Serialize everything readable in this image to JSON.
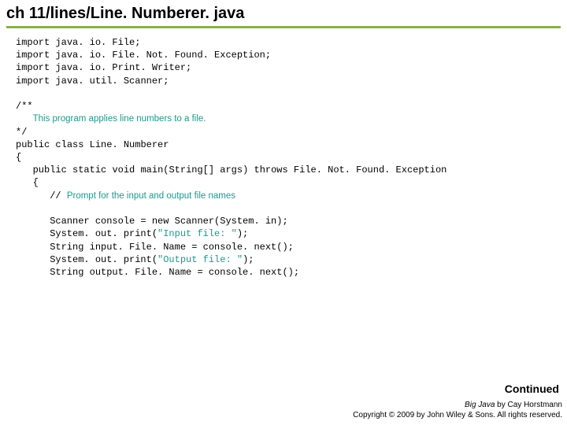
{
  "title": "ch 11/lines/Line. Numberer. java",
  "imp_kw": "import",
  "pub_kw": "public",
  "cls_kw": "class",
  "stat_kw": "static",
  "void_kw": "void",
  "throws_kw": "throws",
  "new_kw": "new",
  "imp1": " java. io. File;",
  "imp2": " java. io. File. Not. Found. Exception;",
  "imp3": " java. io. Print. Writer;",
  "imp4": " java. util. Scanner;",
  "doc_open": "/**",
  "doc_body": "This program applies line numbers to a file.",
  "doc_close": "*/",
  "class_name": " Line. Numberer",
  "brace_open": "{",
  "main_sig_a": " main(String[] args) ",
  "main_sig_b": " File. Not. Found. Exception",
  "prompt_comment_pre": "// ",
  "prompt_comment": "Prompt for the input and output file names",
  "l1a": "      Scanner console = ",
  "l1b": " Scanner(System. in);",
  "l2a": "      System. out. print(",
  "l2s": "\"Input file: \"",
  "l2b": ");",
  "l3": "      String input. File. Name = console. next();",
  "l4a": "      System. out. print(",
  "l4s": "\"Output file: \"",
  "l4b": ");",
  "l5": "      String output. File. Name = console. next();",
  "continued": "Continued",
  "footer_book": "Big Java",
  "footer_by": " by Cay Horstmann",
  "footer_copy": "Copyright © 2009 by John Wiley & Sons. All rights reserved."
}
